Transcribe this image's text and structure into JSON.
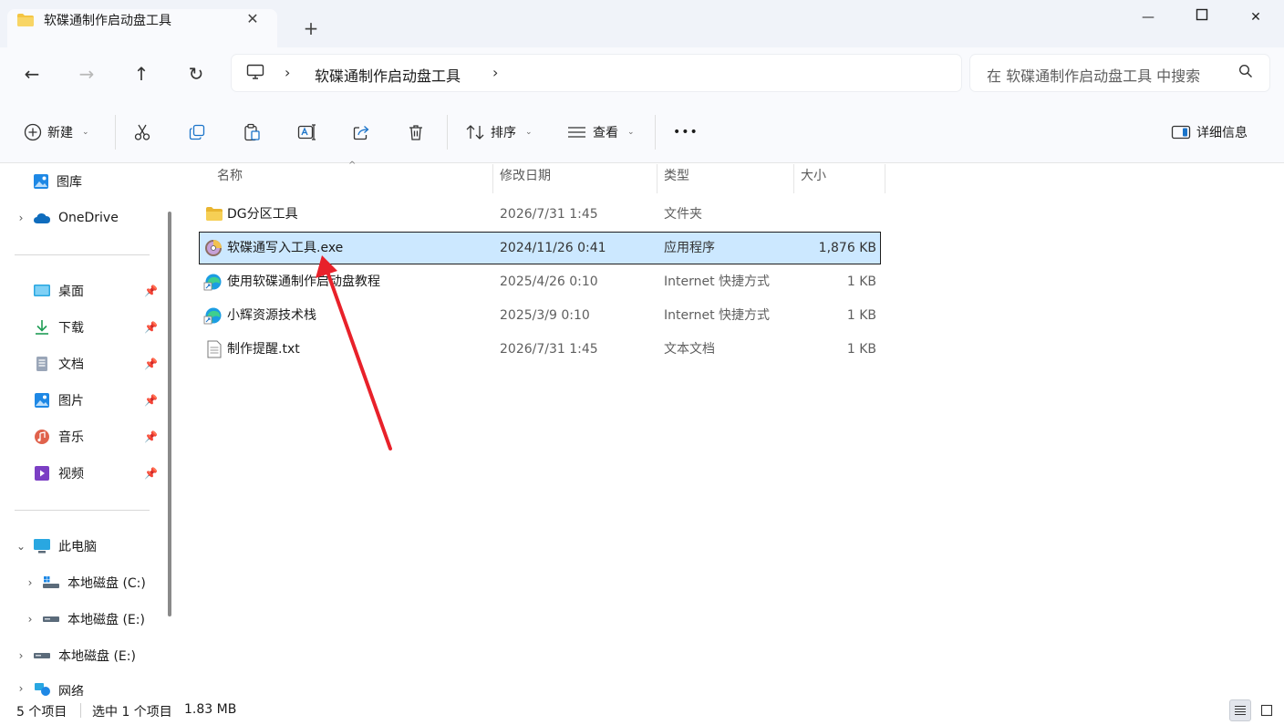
{
  "tab": {
    "title": "软碟通制作启动盘工具",
    "close": "✕",
    "new": "+"
  },
  "window": {
    "minimize": "—",
    "maximize": "☐",
    "close": "✕"
  },
  "nav": {
    "back": "←",
    "forward": "→",
    "up": "↑",
    "refresh": "↻"
  },
  "address": {
    "chevron": "›",
    "crumb": "软碟通制作启动盘工具"
  },
  "search": {
    "placeholder": "在 软碟通制作启动盘工具 中搜索"
  },
  "toolbar": {
    "new_label": "新建",
    "sort_label": "排序",
    "view_label": "查看",
    "more_label": "•••",
    "details_label": "详细信息",
    "caret": "⌄"
  },
  "sidebar": {
    "gallery": "图库",
    "onedrive": "OneDrive",
    "quick": [
      {
        "label": "桌面"
      },
      {
        "label": "下载"
      },
      {
        "label": "文档"
      },
      {
        "label": "图片"
      },
      {
        "label": "音乐"
      },
      {
        "label": "视频"
      }
    ],
    "this_pc": "此电脑",
    "drive_c": "本地磁盘 (C:)",
    "drive_e_sub": "本地磁盘 (E:)",
    "drive_e": "本地磁盘 (E:)",
    "network": "网络"
  },
  "columns": {
    "name": "名称",
    "modified": "修改日期",
    "type": "类型",
    "size": "大小"
  },
  "files": [
    {
      "name": "DG分区工具",
      "modified": "2026/7/31 1:45",
      "type": "文件夹",
      "size": "",
      "icon": "folder-icon"
    },
    {
      "name": "软碟通写入工具.exe",
      "modified": "2024/11/26 0:41",
      "type": "应用程序",
      "size": "1,876 KB",
      "icon": "disc-app-icon"
    },
    {
      "name": "使用软碟通制作启动盘教程",
      "modified": "2025/4/26 0:10",
      "type": "Internet 快捷方式",
      "size": "1 KB",
      "icon": "edge-shortcut-icon"
    },
    {
      "name": "小辉资源技术栈",
      "modified": "2025/3/9 0:10",
      "type": "Internet 快捷方式",
      "size": "1 KB",
      "icon": "edge-shortcut-icon"
    },
    {
      "name": "制作提醒.txt",
      "modified": "2026/7/31 1:45",
      "type": "文本文档",
      "size": "1 KB",
      "icon": "text-file-icon"
    }
  ],
  "status": {
    "count": "5 个项目",
    "selected": "选中 1 个项目",
    "size": "1.83 MB"
  },
  "colors": {
    "selection": "#cce8ff",
    "arrow": "#e8212a",
    "folder": "#f4c542"
  }
}
